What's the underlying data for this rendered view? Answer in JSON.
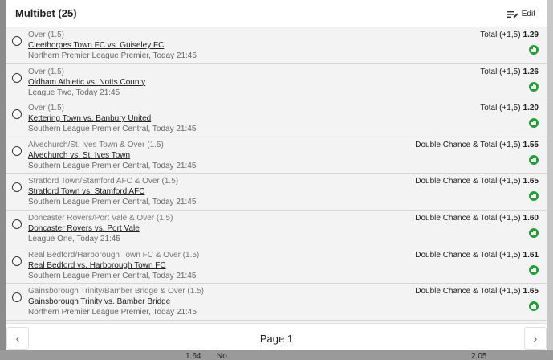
{
  "header": {
    "title": "Multibet (25)",
    "edit_label": "Edit"
  },
  "bets": [
    {
      "selection": "Over (1.5)",
      "match": "Cleethorpes Town FC vs. Guiseley FC",
      "league": "Northern Premier League Premier, Today 21:45",
      "market": "Total (+1,5)",
      "odds": "1.29"
    },
    {
      "selection": "Over (1.5)",
      "match": "Oldham Athletic vs. Notts County",
      "league": "League Two, Today 21:45",
      "market": "Total (+1,5)",
      "odds": "1.26"
    },
    {
      "selection": "Over (1.5)",
      "match": "Kettering Town vs. Banbury United",
      "league": "Southern League Premier Central, Today 21:45",
      "market": "Total (+1,5)",
      "odds": "1.20"
    },
    {
      "selection": "Alvechurch/St. Ives Town & Over (1.5)",
      "match": "Alvechurch vs. St. Ives Town",
      "league": "Southern League Premier Central, Today 21:45",
      "market": "Double Chance & Total (+1,5)",
      "odds": "1.55"
    },
    {
      "selection": "Stratford Town/Stamford AFC & Over (1.5)",
      "match": "Stratford Town vs. Stamford AFC",
      "league": "Southern League Premier Central, Today 21:45",
      "market": "Double Chance & Total (+1,5)",
      "odds": "1.65"
    },
    {
      "selection": "Doncaster Rovers/Port Vale & Over (1.5)",
      "match": "Doncaster Rovers vs. Port Vale",
      "league": "League One, Today 21:45",
      "market": "Double Chance & Total (+1,5)",
      "odds": "1.60"
    },
    {
      "selection": "Real Bedford/Harborough Town FC & Over (1.5)",
      "match": "Real Bedford vs. Harborough Town FC",
      "league": "Southern League Premier Central, Today 21:45",
      "market": "Double Chance & Total (+1,5)",
      "odds": "1.61"
    },
    {
      "selection": "Gainsborough Trinity/Bamber Bridge & Over (1.5)",
      "match": "Gainsborough Trinity vs. Bamber Bridge",
      "league": "Northern Premier League Premier, Today 21:45",
      "market": "Double Chance & Total (+1,5)",
      "odds": "1.65"
    }
  ],
  "footer": {
    "page_label": "Page 1",
    "prev_icon": "‹",
    "next_icon": "›"
  },
  "background": {
    "left_value": "1.64",
    "middle_text": "No",
    "right_value": "2.05"
  },
  "colors": {
    "stat_icon": "#1aa532",
    "panel_bg": "#f3f3f3"
  }
}
